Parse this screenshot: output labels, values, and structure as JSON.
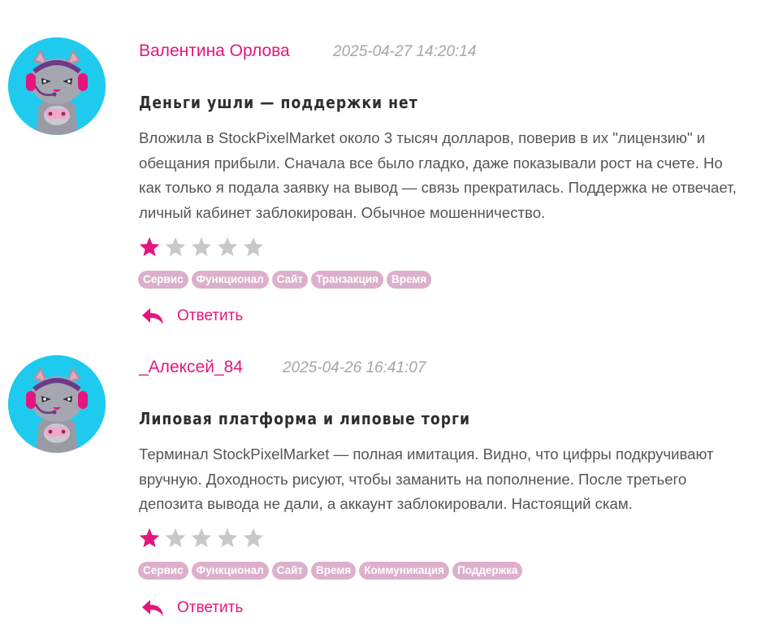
{
  "colors": {
    "accent": "#e5157f",
    "tag_bg": "#dcb0cc",
    "star_filled": "#e5157f",
    "star_empty": "#c8c8c8",
    "avatar_bg": "#1ecbef"
  },
  "reviews": [
    {
      "author": "Валентина Орлова",
      "date": "2025-04-27 14:20:14",
      "title": "Деньги ушли — поддержки нет",
      "body": "Вложила в StockPixelMarket около 3 тысяч долларов, поверив в их \"лицензию\" и обещания прибыли. Сначала все было гладко, даже показывали рост на счете. Но как только я подала заявку на вывод — связь прекратилась. Поддержка не отвечает, личный кабинет заблокирован. Обычное мошенничество.",
      "rating": 1,
      "rating_max": 5,
      "tags": [
        "Сервис",
        "Функционал",
        "Сайт",
        "Транзакция",
        "Время"
      ],
      "reply_label": "Ответить",
      "avatar_icon": "cat-gamer-avatar-icon"
    },
    {
      "author": "_Алексей_84",
      "date": "2025-04-26 16:41:07",
      "title": "Липовая платформа и липовые торги",
      "body": "Терминал StockPixelMarket — полная имитация. Видно, что цифры подкручивают вручную. Доходность рисуют, чтобы заманить на пополнение. После третьего депозита вывода не дали, а аккаунт заблокировали. Настоящий скам.",
      "rating": 1,
      "rating_max": 5,
      "tags": [
        "Сервис",
        "Функционал",
        "Сайт",
        "Время",
        "Коммуникация",
        "Поддержка"
      ],
      "reply_label": "Ответить",
      "avatar_icon": "cat-gamer-avatar-icon"
    }
  ]
}
